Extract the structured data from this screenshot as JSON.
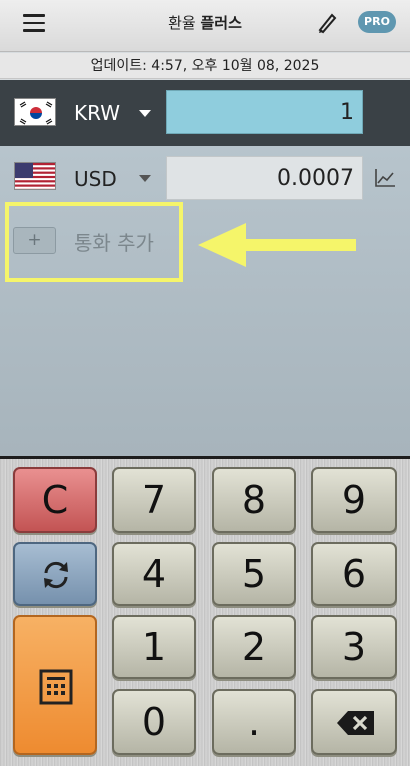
{
  "header": {
    "title_part1": "환율",
    "title_part2": "플러스",
    "pro_label": "PRO"
  },
  "update": {
    "text": "업데이트: 4:57, 오후 10월 08, 2025"
  },
  "currencies": [
    {
      "code": "KRW",
      "amount": "1",
      "flag": "korea-flag"
    },
    {
      "code": "USD",
      "amount": "0.0007",
      "flag": "usa-flag"
    }
  ],
  "add_currency": {
    "plus": "+",
    "label": "통화 추가"
  },
  "keypad": {
    "clear": "C",
    "k7": "7",
    "k8": "8",
    "k9": "9",
    "k4": "4",
    "k5": "5",
    "k6": "6",
    "k1": "1",
    "k2": "2",
    "k3": "3",
    "k0": "0",
    "dot": "."
  },
  "colors": {
    "highlight": "#f5f56a",
    "input_active": "#8fcddd",
    "pro_badge": "#5f97b0",
    "base_row": "#3a4146"
  }
}
